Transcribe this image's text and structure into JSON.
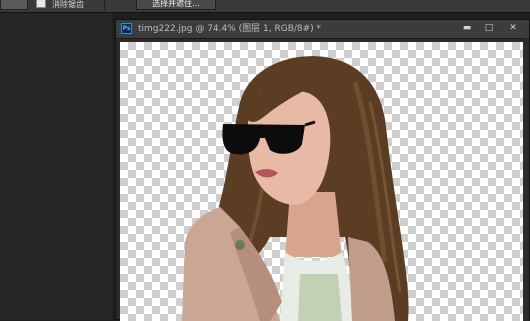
{
  "options_bar": {
    "checkbox_label": "消除锯齿",
    "button_label": "选择并遮住..."
  },
  "document": {
    "title": "timg222.jpg @ 74.4% (图层 1, RGB/8#) *",
    "app_icon": "Ps",
    "minimize": "▬",
    "maximize": "□",
    "close": "✕"
  },
  "canvas": {
    "layer_content": "cutout-woman-with-sunglasses",
    "background": "transparency-checkerboard"
  },
  "colors": {
    "hair": "#5a3d22",
    "coat": "#c9a794",
    "skin": "#e8b9a4",
    "sunglasses": "#0c0c0c"
  }
}
